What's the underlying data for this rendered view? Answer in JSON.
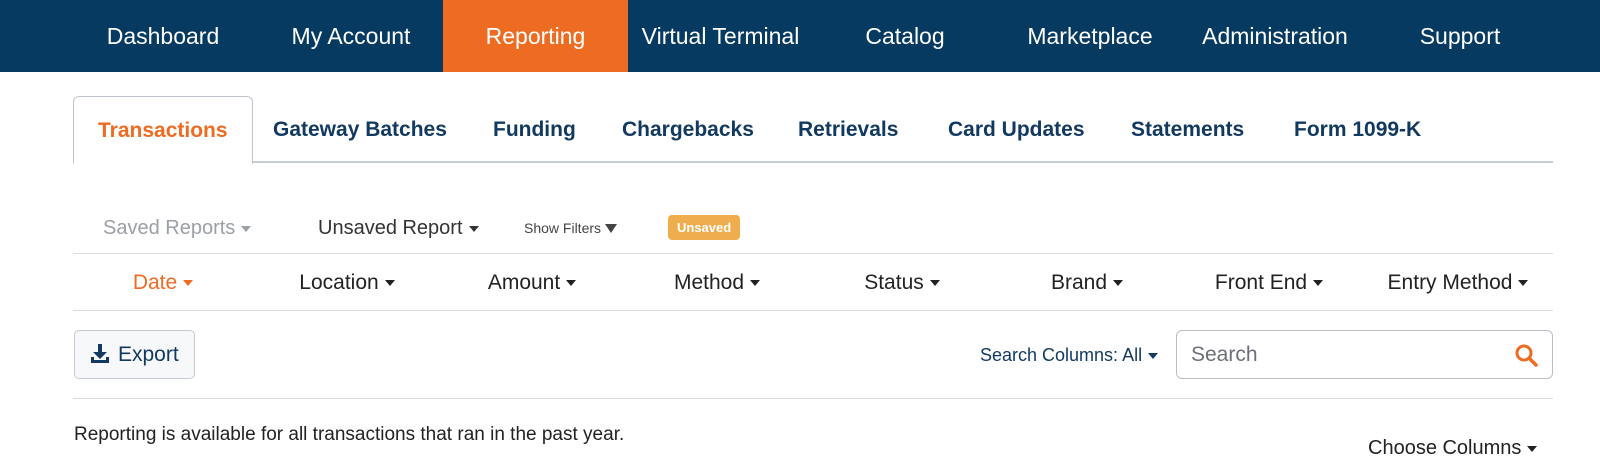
{
  "topnav": {
    "items": [
      {
        "label": "Dashboard"
      },
      {
        "label": "My Account"
      },
      {
        "label": "Reporting",
        "active": true
      },
      {
        "label": "Virtual Terminal"
      },
      {
        "label": "Catalog"
      },
      {
        "label": "Marketplace"
      },
      {
        "label": "Administration"
      },
      {
        "label": "Support"
      }
    ]
  },
  "subtabs": {
    "items": [
      {
        "label": "Transactions",
        "active": true
      },
      {
        "label": "Gateway Batches"
      },
      {
        "label": "Funding"
      },
      {
        "label": "Chargebacks"
      },
      {
        "label": "Retrievals"
      },
      {
        "label": "Card Updates"
      },
      {
        "label": "Statements"
      },
      {
        "label": "Form 1099-K"
      }
    ]
  },
  "report_controls": {
    "saved_reports": "Saved Reports",
    "unsaved_report": "Unsaved Report",
    "show_filters": "Show Filters",
    "status_badge": "Unsaved"
  },
  "filters": {
    "items": [
      {
        "label": "Date",
        "active": true
      },
      {
        "label": "Location"
      },
      {
        "label": "Amount"
      },
      {
        "label": "Method"
      },
      {
        "label": "Status"
      },
      {
        "label": "Brand"
      },
      {
        "label": "Front End"
      },
      {
        "label": "Entry Method"
      }
    ]
  },
  "toolbar": {
    "export_label": "Export",
    "search_columns_label": "Search Columns:",
    "search_columns_value": "All",
    "search_placeholder": "Search"
  },
  "info": {
    "note": "Reporting is available for all transactions that ran in the past year.",
    "choose_columns": "Choose Columns"
  },
  "colors": {
    "nav_bg": "#063a60",
    "accent": "#ee6b22",
    "link": "#123a61",
    "badge": "#f0ad4e"
  },
  "icons": {
    "export": "download-icon",
    "search": "search-icon",
    "dropdown": "caret-down-icon",
    "filter": "funnel-icon"
  }
}
